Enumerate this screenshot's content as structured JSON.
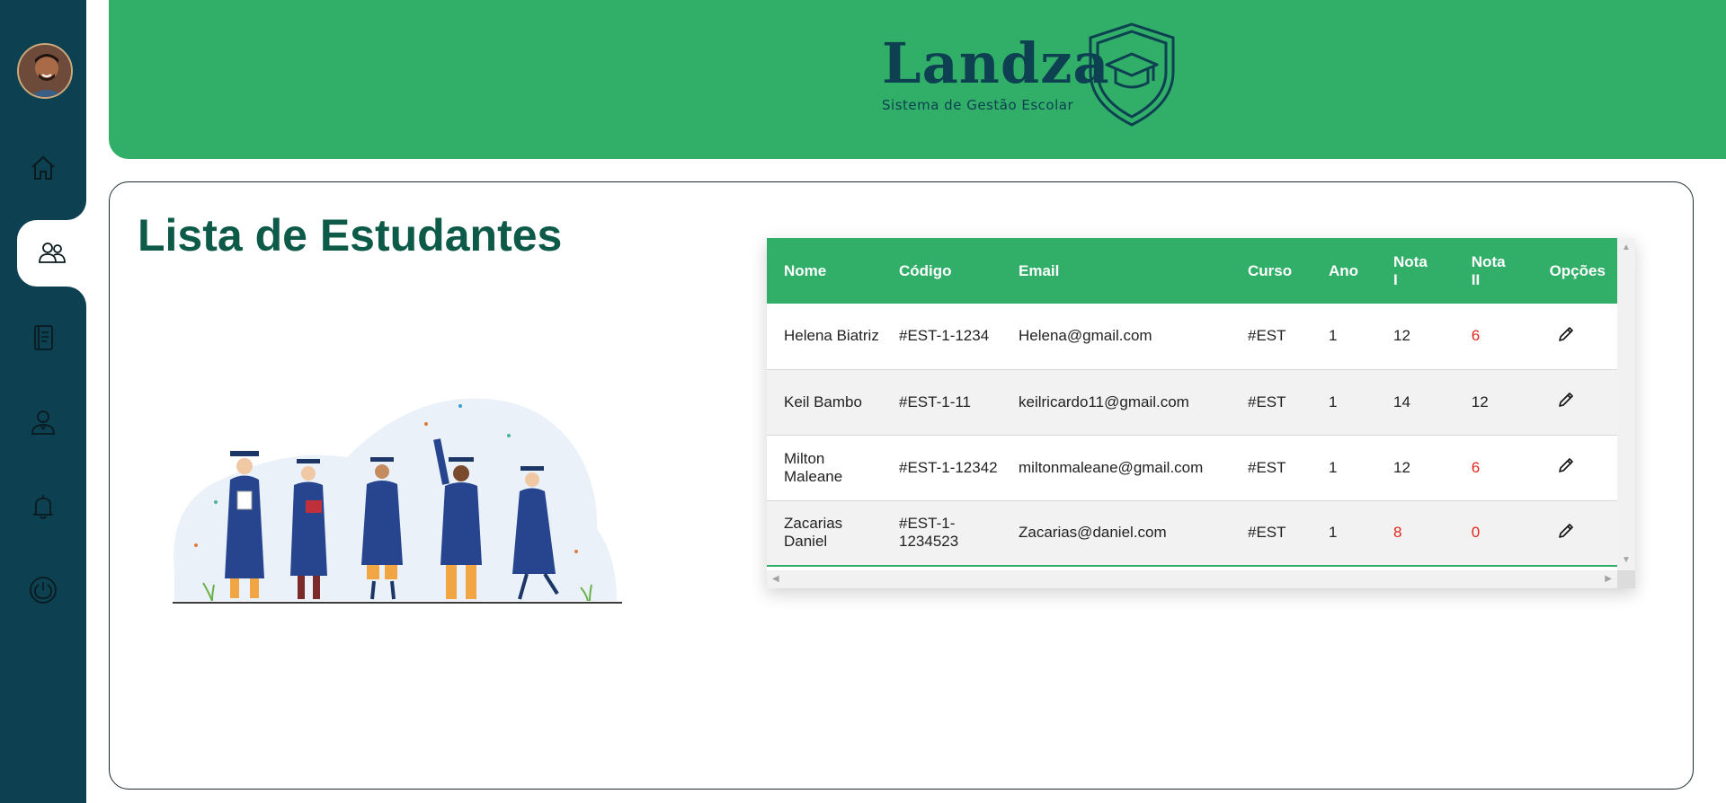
{
  "sidebar": {
    "avatar": "avatar",
    "items": [
      {
        "name": "home-icon",
        "active": false
      },
      {
        "name": "students-icon",
        "active": true
      },
      {
        "name": "notebook-icon",
        "active": false
      },
      {
        "name": "teacher-icon",
        "active": false
      },
      {
        "name": "bell-icon",
        "active": false
      },
      {
        "name": "power-icon",
        "active": false
      }
    ]
  },
  "header": {
    "brand_name": "Landza",
    "brand_subtitle": "Sistema de Gestão Escolar",
    "logo_icon": "graduation-shield-icon"
  },
  "main": {
    "title": "Lista de Estudantes",
    "table": {
      "columns": [
        "Nome",
        "Código",
        "Email",
        "Curso",
        "Ano",
        "Nota I",
        "Nota II",
        "Opções"
      ],
      "rows": [
        {
          "nome": "Helena Biatriz",
          "codigo": "#EST-1-1234",
          "email": "Helena@gmail.com",
          "curso": "#EST",
          "ano": "1",
          "nota1": "12",
          "nota2": "6",
          "nota1_low": false,
          "nota2_low": true
        },
        {
          "nome": "Keil Bambo",
          "codigo": "#EST-1-11",
          "email": "keilricardo11@gmail.com",
          "curso": "#EST",
          "ano": "1",
          "nota1": "14",
          "nota2": "12",
          "nota1_low": false,
          "nota2_low": false
        },
        {
          "nome": "Milton Maleane",
          "codigo": "#EST-1-12342",
          "email": "miltonmaleane@gmail.com",
          "curso": "#EST",
          "ano": "1",
          "nota1": "12",
          "nota2": "6",
          "nota1_low": false,
          "nota2_low": true
        },
        {
          "nome": "Zacarias Daniel",
          "codigo": "#EST-1-1234523",
          "email": "Zacarias@daniel.com",
          "curso": "#EST",
          "ano": "1",
          "nota1": "8",
          "nota2": "0",
          "nota1_low": true,
          "nota2_low": true
        }
      ],
      "edit_icon": "pencil-icon"
    }
  },
  "colors": {
    "sidebar": "#0d4152",
    "header": "#31ae68",
    "title": "#0d5a48",
    "low_grade": "#e0261b"
  }
}
